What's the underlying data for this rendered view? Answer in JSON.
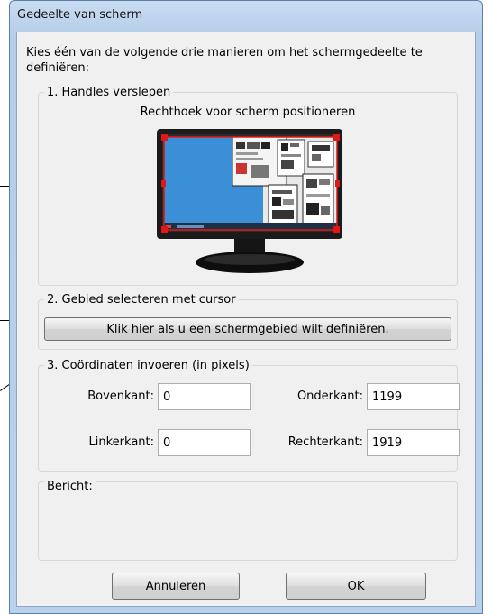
{
  "window": {
    "title": "Gedeelte van scherm"
  },
  "instruction": "Kies één van de volgende drie manieren om het schermgedeelte te definiëren:",
  "group1": {
    "legend": "1. Handles verslepen",
    "caption": "Rechthoek voor scherm positioneren"
  },
  "group2": {
    "legend": "2. Gebied selecteren met cursor",
    "button_label": "Klik hier als u een schermgebied wilt definiëren."
  },
  "group3": {
    "legend": "3. Coördinaten invoeren (in pixels)",
    "top_label": "Bovenkant:",
    "top_value": "0",
    "bottom_label": "Onderkant:",
    "bottom_value": "1199",
    "left_label": "Linkerkant:",
    "left_value": "0",
    "right_label": "Rechterkant:",
    "right_value": "1919"
  },
  "message": {
    "legend": "Bericht:"
  },
  "buttons": {
    "cancel": "Annuleren",
    "ok": "OK"
  },
  "colors": {
    "screen_area": "#3a8fd6",
    "selection_border": "#e01818",
    "handle": "#e01818"
  }
}
